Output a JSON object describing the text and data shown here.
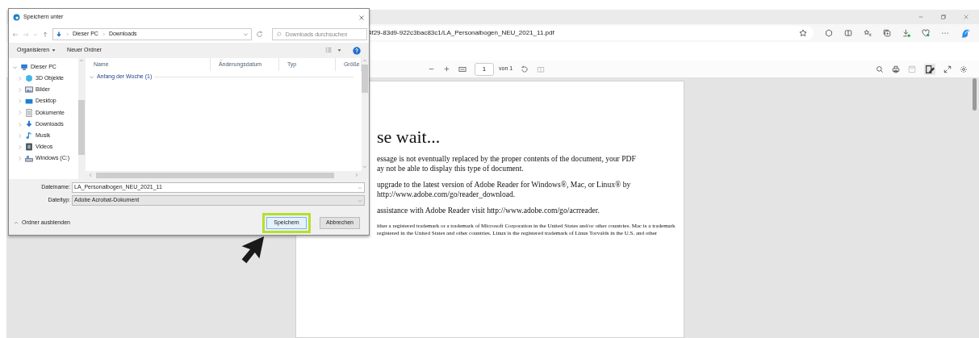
{
  "browser": {
    "address_bar": {
      "url": "4f29-83d9-922c3bac83c1/LA_Personalbogen_NEU_2021_11.pdf"
    },
    "pdf_toolbar": {
      "page_number": "1",
      "page_total": "von 1"
    },
    "pdf_page": {
      "heading": "se wait...",
      "paragraphs": [
        [
          "essage is not eventually replaced by the proper contents of the document, your PDF",
          "ay not be able to display this type of document."
        ],
        [
          "upgrade to the latest version of Adobe Reader for Windows®, Mac, or Linux® by",
          "http://www.adobe.com/go/reader_download."
        ],
        [
          "assistance with Adobe Reader visit  http://www.adobe.com/go/acrreader."
        ]
      ],
      "fine_print": [
        "ither a registered trademark or a trademark of Microsoft Corporation in the United States and/or other countries. Mac is a trademark",
        "registered in the United States and other countries. Linux is the registered trademark of Linus Torvalds in the U.S. and other"
      ]
    }
  },
  "dialog": {
    "title": "Speichern unter",
    "breadcrumb": [
      "Dieser PC",
      "Downloads"
    ],
    "search": {
      "placeholder": "Downloads durchsuchen"
    },
    "toolbar": {
      "organize": "Organisieren",
      "new_folder": "Neuer Ordner"
    },
    "tree": [
      {
        "label": "Dieser PC",
        "kind": "pc",
        "expanded": true,
        "children": [
          {
            "label": "3D Objekte",
            "kind": "objects",
            "expanded": false
          },
          {
            "label": "Bilder",
            "kind": "pictures",
            "expanded": false
          },
          {
            "label": "Desktop",
            "kind": "desktop",
            "expanded": false
          },
          {
            "label": "Dokumente",
            "kind": "documents",
            "expanded": false
          },
          {
            "label": "Downloads",
            "kind": "downloads",
            "expanded": false
          },
          {
            "label": "Musik",
            "kind": "music",
            "expanded": false
          },
          {
            "label": "Videos",
            "kind": "videos",
            "expanded": false
          },
          {
            "label": "Windows (C:)",
            "kind": "drive",
            "expanded": false
          }
        ]
      }
    ],
    "columns": [
      "Name",
      "Änderungsdatum",
      "Typ",
      "Größe"
    ],
    "groups": [
      {
        "label": "Anfang der Woche (1)",
        "expanded": true
      }
    ],
    "filename": {
      "label": "Dateiname:",
      "value": "LA_Personalbogen_NEU_2021_11"
    },
    "filetype": {
      "label": "Dateityp:",
      "value": "Adobe Acrobat-Dokument"
    },
    "hide_folders": "Ordner ausblenden",
    "buttons": [
      {
        "label": "Speichern",
        "highlighted": true
      },
      {
        "label": "Abbrechen",
        "highlighted": false
      }
    ]
  }
}
